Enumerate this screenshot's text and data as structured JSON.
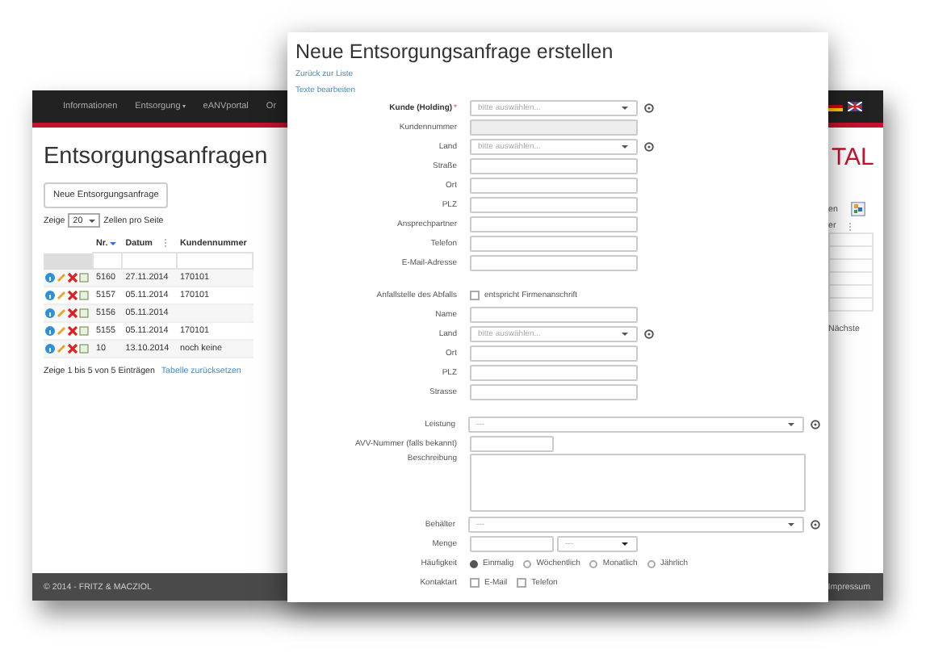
{
  "page": {
    "nav": [
      {
        "label": "Informationen",
        "dropdown": false
      },
      {
        "label": "Entsorgung",
        "dropdown": true
      },
      {
        "label": "eANVportal",
        "dropdown": false
      },
      {
        "label": "Or",
        "dropdown": false
      }
    ],
    "title": "Entsorgungsanfragen",
    "new_button": "Neue Entsorgungsanfrage",
    "page_size": {
      "before": "Zeige",
      "value": "20",
      "after": "Zellen pro Seite"
    },
    "table": {
      "columns": [
        {
          "label": "Nr.",
          "sorted": true
        },
        {
          "label": "Datum",
          "sorted": false
        },
        {
          "label": "Kundennummer"
        }
      ],
      "rows": [
        {
          "nr": "5160",
          "datum": "27.11.2014",
          "kundennummer": "170101"
        },
        {
          "nr": "5157",
          "datum": "05.11.2014",
          "kundennummer": "170101"
        },
        {
          "nr": "5156",
          "datum": "05.11.2014"
        },
        {
          "nr": "5155",
          "datum": "05.11.2014",
          "kundennummer": "170101"
        },
        {
          "nr": "10",
          "datum": "13.10.2014",
          "kundennummer": "noch keine"
        }
      ]
    },
    "info": "Zeige 1 bis 5 von 5 Einträgen",
    "reset_link": "Tabelle zurücksetzen",
    "brand_fragment": "TAL",
    "right_fragments": [
      "en",
      "er"
    ],
    "next": "Nächste",
    "footer": {
      "copyright": "© 2014 - FRITZ & MACZIOL",
      "link": "Impressum"
    }
  },
  "dialog": {
    "title": "Neue Entsorgungsanfrage erstellen",
    "links": [
      "Zurück zur Liste",
      "Texte bearbeiten"
    ],
    "sections": [
      [
        {
          "label": "Kunde (Holding)",
          "required_mark": "*",
          "kind": "select",
          "placeholder": "bitte auswählen...",
          "help": true
        },
        {
          "label": "Kundennummer",
          "kind": "readonly"
        },
        {
          "label": "Land",
          "kind": "select",
          "placeholder": "bitte auswählen...",
          "help": true
        },
        {
          "label": "Straße",
          "kind": "text"
        },
        {
          "label": "Ort",
          "kind": "text"
        },
        {
          "label": "PLZ",
          "kind": "text"
        },
        {
          "label": "Ansprechpartner",
          "kind": "text"
        },
        {
          "label": "Telefon",
          "kind": "text"
        },
        {
          "label": "E-Mail-Adresse",
          "kind": "text"
        }
      ],
      [
        {
          "label": "Anfallstelle des Abfalls",
          "kind": "checkbox",
          "option": "entspricht Firmenanschrift",
          "checked": false
        },
        {
          "label": "Name",
          "kind": "text"
        },
        {
          "label": "Land",
          "kind": "select",
          "placeholder": "bitte auswählen...",
          "help": true
        },
        {
          "label": "Ort",
          "kind": "text"
        },
        {
          "label": "PLZ",
          "kind": "text"
        },
        {
          "label": "Strasse",
          "kind": "text"
        }
      ],
      [
        {
          "label": "Leistung",
          "kind": "wide-select",
          "placeholder": "---",
          "help": true
        },
        {
          "label": "AVV-Nummer (falls bekannt)",
          "kind": "short"
        },
        {
          "label": "Beschreibung",
          "kind": "textarea"
        },
        {
          "label": "Behälter",
          "kind": "wide-select",
          "placeholder": "---",
          "help": true
        },
        {
          "label": "Menge",
          "kind": "amount",
          "placeholder": "---"
        },
        {
          "label": "Häufigkeit",
          "kind": "radio",
          "options": [
            {
              "label": "Einmalig",
              "selected": true
            },
            {
              "label": "Wöchentlich",
              "selected": false
            },
            {
              "label": "Monatlich",
              "selected": false
            },
            {
              "label": "Jährlich",
              "selected": false
            }
          ]
        },
        {
          "label": "Kontaktart",
          "kind": "checks",
          "options": [
            {
              "label": "E-Mail",
              "checked": false
            },
            {
              "label": "Telefon",
              "checked": false
            }
          ]
        }
      ]
    ]
  }
}
